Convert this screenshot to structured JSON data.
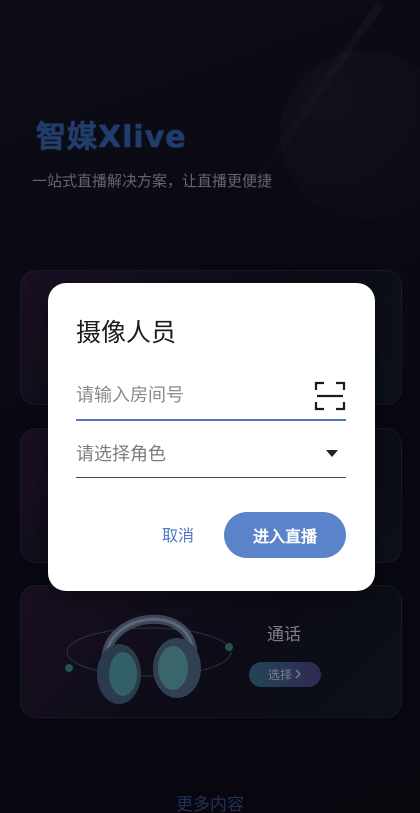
{
  "app": {
    "logo": "智媒Xlive",
    "tagline": "一站式直播解决方案，让直播更便捷"
  },
  "cards": [
    {
      "title": "通话",
      "button_label": "选择",
      "button_icon": "chevron-right-icon"
    }
  ],
  "footer": {
    "more_label": "更多内容"
  },
  "dialog": {
    "title": "摄像人员",
    "room_input": {
      "placeholder": "请输入房间号",
      "value": "",
      "icon": "scan-icon"
    },
    "role_select": {
      "placeholder": "请选择角色",
      "icon": "caret-down-icon"
    },
    "cancel_label": "取消",
    "enter_label": "进入直播"
  },
  "colors": {
    "accent": "#5b83c9",
    "logo": "#3d6fc6",
    "background": "#0f0e1c"
  }
}
